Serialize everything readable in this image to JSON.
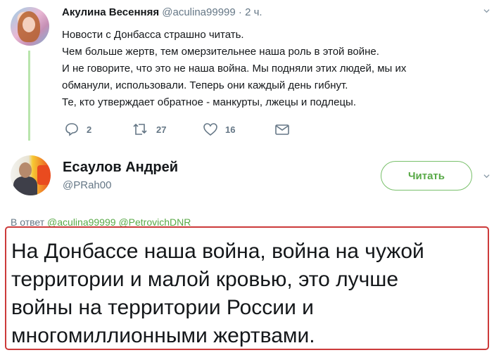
{
  "parent_tweet": {
    "name": "Акулина Весенняя",
    "handle": "@aculina99999",
    "separator": "·",
    "time": "2 ч.",
    "text_lines": [
      "Новости с Донбасса страшно читать.",
      "Чем больше жертв, тем омерзительнее наша роль в этой войне.",
      "И не говорите, что это не наша война. Мы подняли этих людей, мы их",
      "обманули, использовали. Теперь они каждый день гибнут.",
      "Те, кто утверждает обратное - манкурты, лжецы и подлецы."
    ],
    "actions": {
      "reply_count": "2",
      "retweet_count": "27",
      "like_count": "16"
    }
  },
  "reply_tweet": {
    "name": "Есаулов Андрей",
    "handle": "@PRah00",
    "follow_label": "Читать",
    "reply_prefix": "В ответ",
    "mentions": [
      "@aculina99999",
      "@PetrovichDNR"
    ],
    "text_lines": [
      "На Донбассе наша война, война на чужой",
      "территории и малой кровью, это лучше",
      "войны на территории России и",
      "многомиллионными жертвами."
    ]
  },
  "colors": {
    "accent_green": "#58a947",
    "thread_line": "#b9e5ad",
    "secondary_text": "#657786",
    "highlight_border": "#cc3a3a"
  },
  "icons": [
    "reply-icon",
    "retweet-icon",
    "like-icon",
    "message-icon",
    "chevron-down-icon"
  ]
}
